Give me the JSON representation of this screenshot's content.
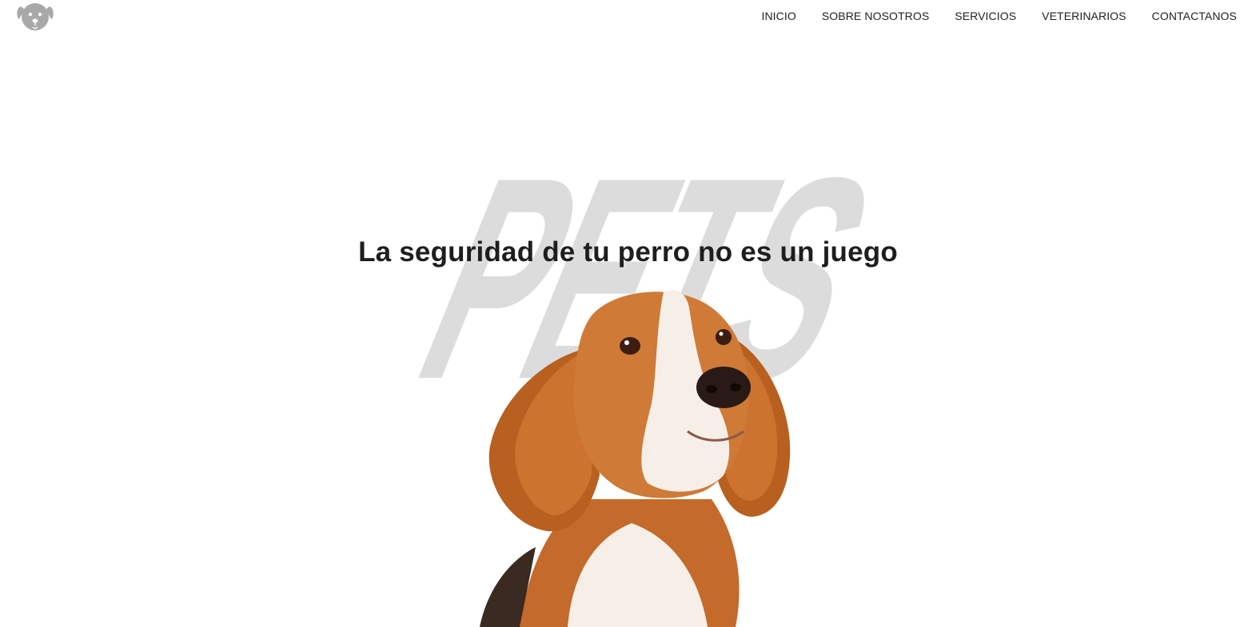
{
  "header": {
    "logo_icon": "dog-face-icon",
    "nav": [
      {
        "label": "INICIO"
      },
      {
        "label": "SOBRE NOSOTROS"
      },
      {
        "label": "SERVICIOS"
      },
      {
        "label": "VETERINARIOS"
      },
      {
        "label": "CONTACTANOS"
      }
    ]
  },
  "hero": {
    "watermark": "PETS",
    "title": "La seguridad de tu perro no es un juego",
    "image": "beagle-dog-photo"
  },
  "colors": {
    "watermark": "#dcdcdc",
    "title": "#1e1e1e",
    "nav_text": "#222222",
    "logo": "#a8a8a8",
    "dog_orange": "#c46a2a",
    "dog_white": "#f5efe8"
  }
}
